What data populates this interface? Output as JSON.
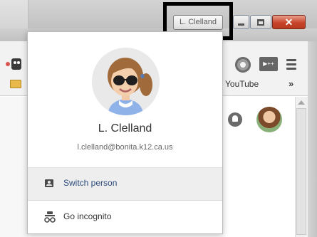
{
  "window": {
    "profile_chip_label": "L. Clelland",
    "close_glyph": "✕"
  },
  "toolbar": {
    "media_icon_text": "▶++",
    "bookmarks": {
      "youtube_label": "YouTube",
      "more_label": "»"
    }
  },
  "profile_menu": {
    "name": "L. Clelland",
    "email": "l.clelland@bonita.k12.ca.us",
    "items": [
      {
        "label": "Switch person",
        "icon": "person-card-icon"
      },
      {
        "label": "Go incognito",
        "icon": "incognito-icon"
      }
    ]
  },
  "colors": {
    "close_button": "#c8452a",
    "switch_row_bg": "#eeeeee",
    "switch_text": "#2c4c7c"
  }
}
